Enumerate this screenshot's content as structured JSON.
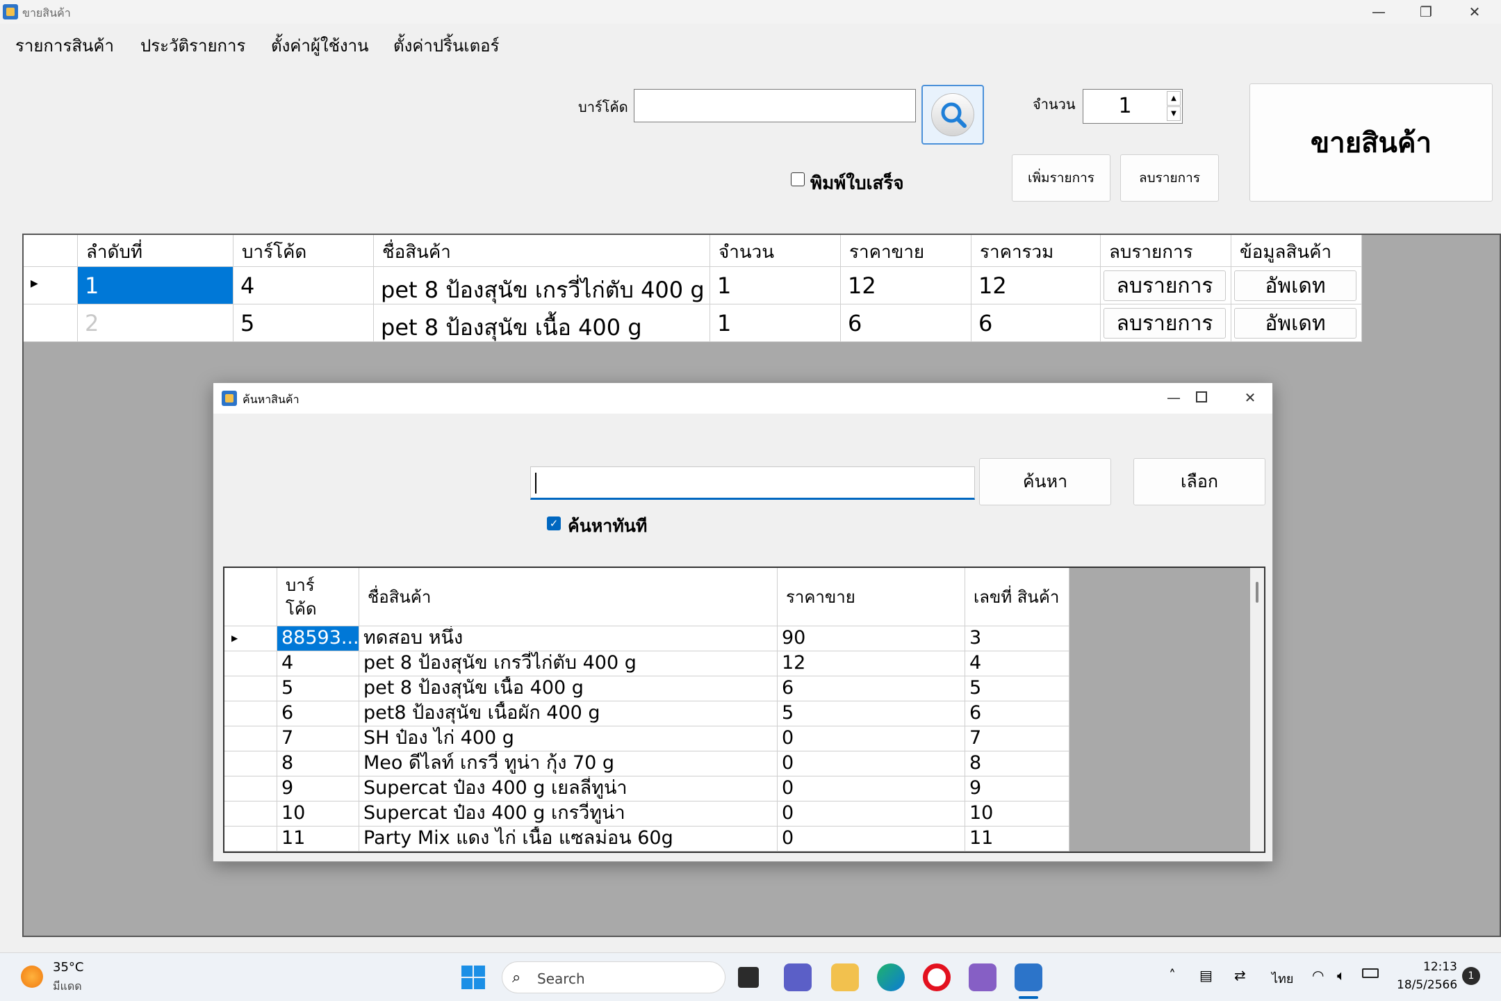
{
  "window": {
    "title": "ขายสินค้า",
    "minimize_glyph": "—",
    "maximize_glyph": "❐",
    "close_glyph": "✕"
  },
  "menu": [
    {
      "label": "รายการสินค้า"
    },
    {
      "label": "ประวัติรายการ"
    },
    {
      "label": "ตั้งค่าผู้ใช้งาน"
    },
    {
      "label": "ตั้งค่าปริ้นเตอร์"
    }
  ],
  "form": {
    "barcode_label": "บาร์โค้ด",
    "barcode_value": "",
    "search_icon": "search-icon",
    "quantity_label": "จำนวน",
    "quantity_value": "1",
    "print_receipt_label": "พิมพ์ใบเสร็จ",
    "print_receipt_checked": false,
    "add_item_label": "เพิ่มรายการ",
    "remove_item_label": "ลบรายการ",
    "sell_label": "ขายสินค้า"
  },
  "cart_grid": {
    "columns": [
      "ลำดับที่",
      "บาร์โค้ด",
      "ชื่อสินค้า",
      "จำนวน",
      "ราคาขาย",
      "ราคารวม",
      "ลบรายการ",
      "ข้อมูลสินค้า"
    ],
    "rows": [
      {
        "no": "1",
        "barcode": "4",
        "name": "pet 8 ป้องสุนัข เกรวี่ไก่ตับ 400 g",
        "qty": "1",
        "price": "12",
        "total": "12",
        "remove": "ลบรายการ",
        "update": "อัพเดท"
      },
      {
        "no": "2",
        "barcode": "5",
        "name": "pet 8 ป้องสุนัข เนื้อ 400 g",
        "qty": "1",
        "price": "6",
        "total": "6",
        "remove": "ลบรายการ",
        "update": "อัพเดท"
      }
    ],
    "selected_row": 0
  },
  "dialog": {
    "title": "ค้นหาสินค้า",
    "search_value": "",
    "search_button": "ค้นหา",
    "select_button": "เลือก",
    "instant_search_label": "ค้นหาทันที",
    "instant_search_checked": true,
    "columns": [
      "บาร์ โค้ด",
      "ชื่อสินค้า",
      "ราคาขาย",
      "เลขที่ สินค้า"
    ],
    "rows": [
      {
        "barcode": "88593...",
        "name": "ทดสอบ หนึ่ง",
        "price": "90",
        "id": "3"
      },
      {
        "barcode": "4",
        "name": "pet 8 ป้องสุนัข เกรวี่ไก่ตับ 400 g",
        "price": "12",
        "id": "4"
      },
      {
        "barcode": "5",
        "name": "pet 8 ป้องสุนัข เนื้อ 400 g",
        "price": "6",
        "id": "5"
      },
      {
        "barcode": "6",
        "name": "pet8 ป้องสุนัข เนื้อผัก 400 g",
        "price": "5",
        "id": "6"
      },
      {
        "barcode": "7",
        "name": "SH ป๋อง ไก่ 400 g",
        "price": "0",
        "id": "7"
      },
      {
        "barcode": "8",
        "name": "Meo ดีไลท์ เกรวี่ ทูน่า กุ้ง 70 g",
        "price": "0",
        "id": "8"
      },
      {
        "barcode": "9",
        "name": "Supercat ป๋อง 400 g เยลลี่ทูน่า",
        "price": "0",
        "id": "9"
      },
      {
        "barcode": "10",
        "name": "Supercat ป๋อง 400 g เกรวี่ทูน่า",
        "price": "0",
        "id": "10"
      },
      {
        "barcode": "11",
        "name": "Party Mix แดง ไก่ เนื้อ แซลม่อน 60g",
        "price": "0",
        "id": "11"
      }
    ]
  },
  "taskbar": {
    "weather_temp": "35°C",
    "weather_desc": "มีแดด",
    "search_placeholder": "Search",
    "language": "ไทย",
    "time": "12:13",
    "date": "18/5/2566",
    "notification_count": "1"
  }
}
